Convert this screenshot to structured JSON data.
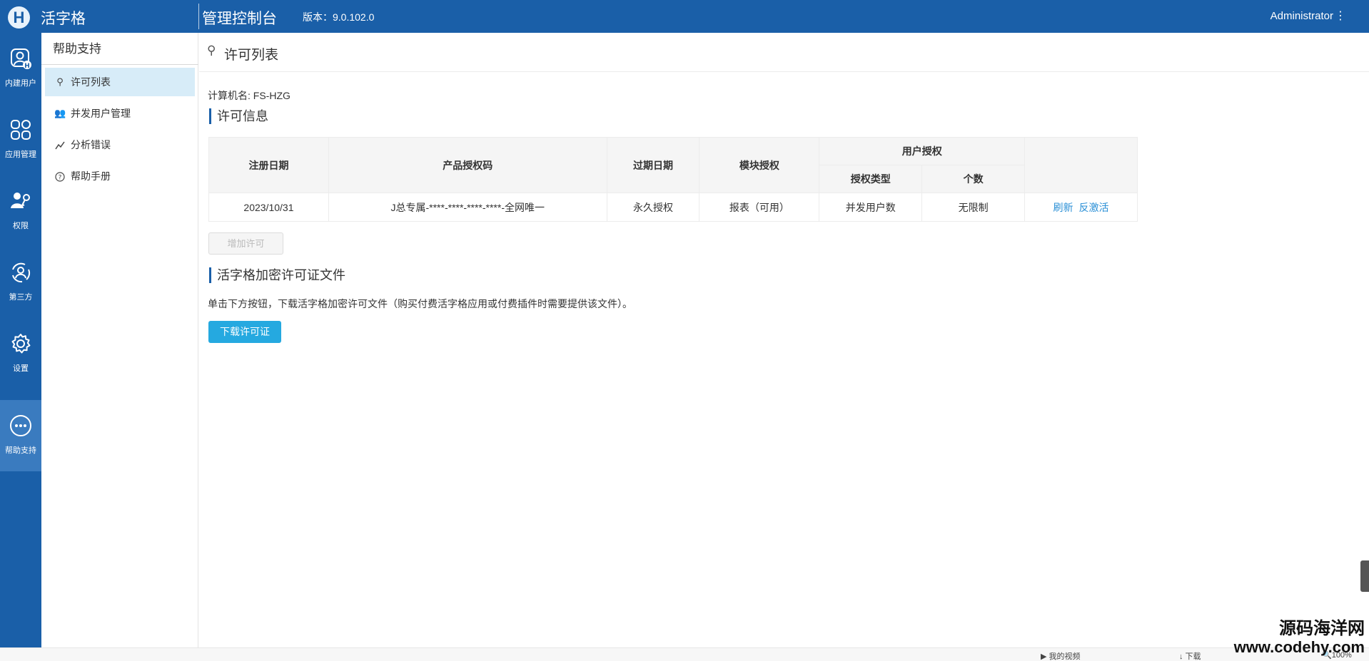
{
  "topbar": {
    "logo_letter": "H",
    "app_name": "活字格",
    "console_title": "管理控制台",
    "version": "版本：9.0.102.0",
    "user": "Administrator",
    "menu_glyph": "⋮"
  },
  "leftnav": {
    "items": [
      {
        "label": "内建用户",
        "icon": "builtin-user-icon"
      },
      {
        "label": "应用管理",
        "icon": "app-grid-icon"
      },
      {
        "label": "权限",
        "icon": "permission-key-icon"
      },
      {
        "label": "第三方",
        "icon": "third-party-icon"
      },
      {
        "label": "设置",
        "icon": "gear-icon"
      },
      {
        "label": "帮助支持",
        "icon": "more-dots-icon",
        "active": true
      }
    ]
  },
  "subnav": {
    "title": "帮助支持",
    "items": [
      {
        "label": "许可列表",
        "icon": "key-icon",
        "active": true
      },
      {
        "label": "并发用户管理",
        "icon": "users-icon"
      },
      {
        "label": "分析错误",
        "icon": "chart-line-icon"
      },
      {
        "label": "帮助手册",
        "icon": "help-circle-icon"
      }
    ]
  },
  "main": {
    "page_title": "许可列表",
    "machine_name": "计算机名: FS-HZG",
    "section_license": "许可信息",
    "table": {
      "headers": {
        "reg_date": "注册日期",
        "product_code": "产品授权码",
        "expire_date": "过期日期",
        "module": "模块授权",
        "user_auth": "用户授权",
        "auth_type": "授权类型",
        "count": "个数"
      },
      "rows": [
        {
          "reg_date": "2023/10/31",
          "product_code": "J总专属-****-****-****-****-全网唯一",
          "expire_date": "永久授权",
          "module": "报表（可用）",
          "auth_type": "并发用户数",
          "count": "无限制",
          "action_refresh": "刷新",
          "action_deactivate": "反激活"
        }
      ]
    },
    "add_license_button": "增加许可",
    "section_file": "活字格加密许可证文件",
    "file_description": "单击下方按钮，下载活字格加密许可文件（购买付费活字格应用或付费插件时需要提供该文件）。",
    "download_button": "下载许可证"
  },
  "statusbar": {
    "my_videos": "▶ 我的视频",
    "download": "↓ 下载",
    "zoom": "🔍100%"
  },
  "watermark": {
    "line1": "源码海洋网",
    "line2": "www.codehy.com"
  },
  "colors": {
    "brand": "#1a5fa8",
    "active_nav": "#3a7bbf",
    "subnav_active": "#d7ecf8",
    "primary_button": "#25a9e0",
    "link": "#2a8fd6"
  }
}
